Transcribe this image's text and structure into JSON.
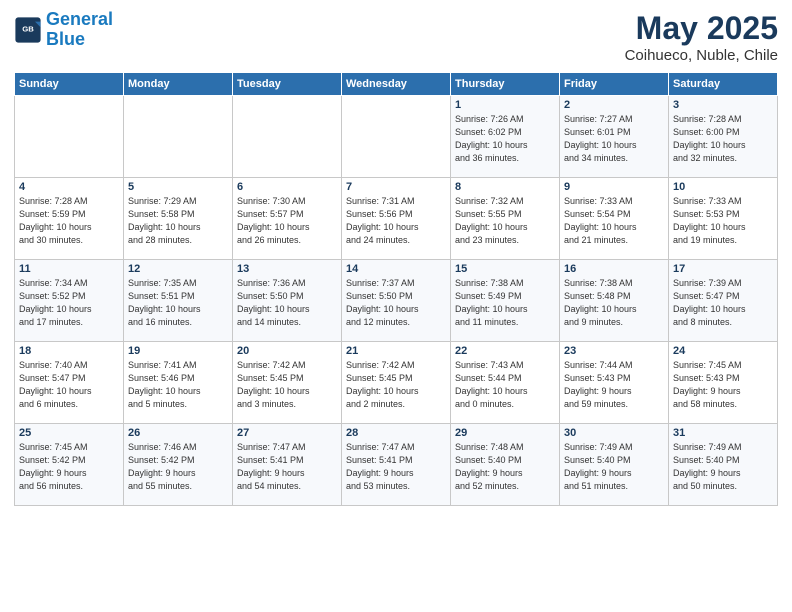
{
  "header": {
    "logo_line1": "General",
    "logo_line2": "Blue",
    "title": "May 2025",
    "subtitle": "Coihueco, Nuble, Chile"
  },
  "days_of_week": [
    "Sunday",
    "Monday",
    "Tuesday",
    "Wednesday",
    "Thursday",
    "Friday",
    "Saturday"
  ],
  "weeks": [
    [
      {
        "day": "",
        "info": ""
      },
      {
        "day": "",
        "info": ""
      },
      {
        "day": "",
        "info": ""
      },
      {
        "day": "",
        "info": ""
      },
      {
        "day": "1",
        "info": "Sunrise: 7:26 AM\nSunset: 6:02 PM\nDaylight: 10 hours\nand 36 minutes."
      },
      {
        "day": "2",
        "info": "Sunrise: 7:27 AM\nSunset: 6:01 PM\nDaylight: 10 hours\nand 34 minutes."
      },
      {
        "day": "3",
        "info": "Sunrise: 7:28 AM\nSunset: 6:00 PM\nDaylight: 10 hours\nand 32 minutes."
      }
    ],
    [
      {
        "day": "4",
        "info": "Sunrise: 7:28 AM\nSunset: 5:59 PM\nDaylight: 10 hours\nand 30 minutes."
      },
      {
        "day": "5",
        "info": "Sunrise: 7:29 AM\nSunset: 5:58 PM\nDaylight: 10 hours\nand 28 minutes."
      },
      {
        "day": "6",
        "info": "Sunrise: 7:30 AM\nSunset: 5:57 PM\nDaylight: 10 hours\nand 26 minutes."
      },
      {
        "day": "7",
        "info": "Sunrise: 7:31 AM\nSunset: 5:56 PM\nDaylight: 10 hours\nand 24 minutes."
      },
      {
        "day": "8",
        "info": "Sunrise: 7:32 AM\nSunset: 5:55 PM\nDaylight: 10 hours\nand 23 minutes."
      },
      {
        "day": "9",
        "info": "Sunrise: 7:33 AM\nSunset: 5:54 PM\nDaylight: 10 hours\nand 21 minutes."
      },
      {
        "day": "10",
        "info": "Sunrise: 7:33 AM\nSunset: 5:53 PM\nDaylight: 10 hours\nand 19 minutes."
      }
    ],
    [
      {
        "day": "11",
        "info": "Sunrise: 7:34 AM\nSunset: 5:52 PM\nDaylight: 10 hours\nand 17 minutes."
      },
      {
        "day": "12",
        "info": "Sunrise: 7:35 AM\nSunset: 5:51 PM\nDaylight: 10 hours\nand 16 minutes."
      },
      {
        "day": "13",
        "info": "Sunrise: 7:36 AM\nSunset: 5:50 PM\nDaylight: 10 hours\nand 14 minutes."
      },
      {
        "day": "14",
        "info": "Sunrise: 7:37 AM\nSunset: 5:50 PM\nDaylight: 10 hours\nand 12 minutes."
      },
      {
        "day": "15",
        "info": "Sunrise: 7:38 AM\nSunset: 5:49 PM\nDaylight: 10 hours\nand 11 minutes."
      },
      {
        "day": "16",
        "info": "Sunrise: 7:38 AM\nSunset: 5:48 PM\nDaylight: 10 hours\nand 9 minutes."
      },
      {
        "day": "17",
        "info": "Sunrise: 7:39 AM\nSunset: 5:47 PM\nDaylight: 10 hours\nand 8 minutes."
      }
    ],
    [
      {
        "day": "18",
        "info": "Sunrise: 7:40 AM\nSunset: 5:47 PM\nDaylight: 10 hours\nand 6 minutes."
      },
      {
        "day": "19",
        "info": "Sunrise: 7:41 AM\nSunset: 5:46 PM\nDaylight: 10 hours\nand 5 minutes."
      },
      {
        "day": "20",
        "info": "Sunrise: 7:42 AM\nSunset: 5:45 PM\nDaylight: 10 hours\nand 3 minutes."
      },
      {
        "day": "21",
        "info": "Sunrise: 7:42 AM\nSunset: 5:45 PM\nDaylight: 10 hours\nand 2 minutes."
      },
      {
        "day": "22",
        "info": "Sunrise: 7:43 AM\nSunset: 5:44 PM\nDaylight: 10 hours\nand 0 minutes."
      },
      {
        "day": "23",
        "info": "Sunrise: 7:44 AM\nSunset: 5:43 PM\nDaylight: 9 hours\nand 59 minutes."
      },
      {
        "day": "24",
        "info": "Sunrise: 7:45 AM\nSunset: 5:43 PM\nDaylight: 9 hours\nand 58 minutes."
      }
    ],
    [
      {
        "day": "25",
        "info": "Sunrise: 7:45 AM\nSunset: 5:42 PM\nDaylight: 9 hours\nand 56 minutes."
      },
      {
        "day": "26",
        "info": "Sunrise: 7:46 AM\nSunset: 5:42 PM\nDaylight: 9 hours\nand 55 minutes."
      },
      {
        "day": "27",
        "info": "Sunrise: 7:47 AM\nSunset: 5:41 PM\nDaylight: 9 hours\nand 54 minutes."
      },
      {
        "day": "28",
        "info": "Sunrise: 7:47 AM\nSunset: 5:41 PM\nDaylight: 9 hours\nand 53 minutes."
      },
      {
        "day": "29",
        "info": "Sunrise: 7:48 AM\nSunset: 5:40 PM\nDaylight: 9 hours\nand 52 minutes."
      },
      {
        "day": "30",
        "info": "Sunrise: 7:49 AM\nSunset: 5:40 PM\nDaylight: 9 hours\nand 51 minutes."
      },
      {
        "day": "31",
        "info": "Sunrise: 7:49 AM\nSunset: 5:40 PM\nDaylight: 9 hours\nand 50 minutes."
      }
    ]
  ]
}
